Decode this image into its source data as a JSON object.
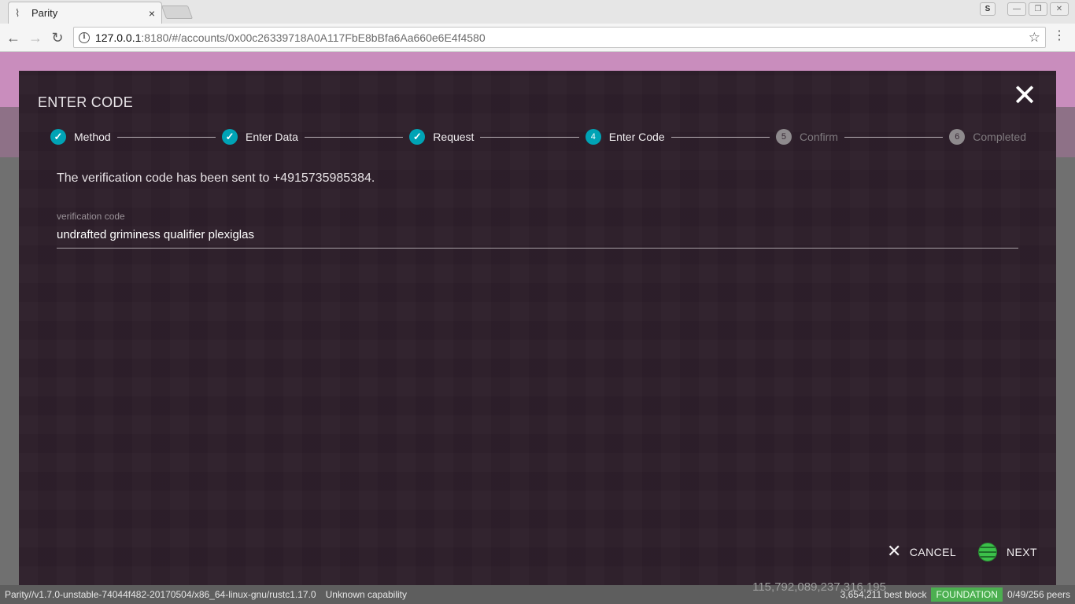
{
  "browser": {
    "tab_title": "Parity",
    "tab_close": "×",
    "url_host": "127.0.0.1",
    "url_rest": ":8180/#/accounts/0x00c26339718A0A117FbE8bBfa6Aa660e6E4f4580",
    "ext_badge": "S"
  },
  "modal": {
    "title": "ENTER CODE",
    "close": "✕",
    "steps": [
      {
        "number": "1",
        "label": "Method",
        "state": "done"
      },
      {
        "number": "2",
        "label": "Enter Data",
        "state": "done"
      },
      {
        "number": "3",
        "label": "Request",
        "state": "done"
      },
      {
        "number": "4",
        "label": "Enter Code",
        "state": "active"
      },
      {
        "number": "5",
        "label": "Confirm",
        "state": "pending"
      },
      {
        "number": "6",
        "label": "Completed",
        "state": "pending"
      }
    ],
    "sent_text": "The verification code has been sent to +4915735985384.",
    "field_label": "verification code",
    "field_value": "undrafted griminess qualifier plexiglas",
    "cancel_label": "CANCEL",
    "next_label": "NEXT"
  },
  "status": {
    "version": "Parity//v1.7.0-unstable-74044f482-20170504/x86_64-linux-gnu/rustc1.17.0",
    "capability": "Unknown capability",
    "balance_overlay": "115,792,089,237,316,195",
    "best_block": "3,654,211 best block",
    "chain": "FOUNDATION",
    "peers": "0/49/256 peers"
  },
  "colors": {
    "accent": "#00a3b5",
    "modal_bg": "#2e1f2b",
    "chain_badge": "#4caf50"
  }
}
